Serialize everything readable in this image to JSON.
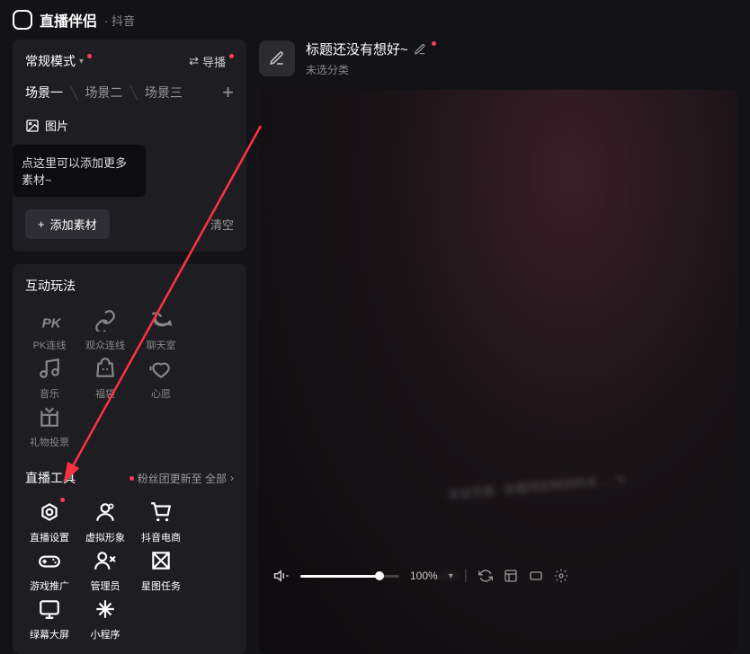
{
  "app": {
    "title": "直播伴侣",
    "subtitle": "· 抖音"
  },
  "mode": {
    "label": "常规模式",
    "nav": "导播"
  },
  "scenes": {
    "tabs": [
      "场景一",
      "场景二",
      "场景三"
    ]
  },
  "source": {
    "image": "图片"
  },
  "hint": "点这里可以添加更多素材~",
  "add": {
    "label": "添加素材",
    "clear": "清空"
  },
  "interactive": {
    "title": "互动玩法",
    "items": [
      {
        "label": "PK连线",
        "icon": "pk"
      },
      {
        "label": "观众连线",
        "icon": "link"
      },
      {
        "label": "聊天室",
        "icon": "chat"
      },
      {
        "label": "音乐",
        "icon": "music"
      },
      {
        "label": "福袋",
        "icon": "bag"
      },
      {
        "label": "心愿",
        "icon": "heart"
      },
      {
        "label": "礼物投票",
        "icon": "gift"
      }
    ]
  },
  "tools": {
    "title": "直播工具",
    "fans_update": "粉丝团更新至 全部",
    "items": [
      {
        "label": "直播设置",
        "icon": "gear",
        "dot": true
      },
      {
        "label": "虚拟形象",
        "icon": "avatar"
      },
      {
        "label": "抖音电商",
        "icon": "cart"
      },
      {
        "label": "游戏推广",
        "icon": "gamepad"
      },
      {
        "label": "管理员",
        "icon": "admin"
      },
      {
        "label": "星图任务",
        "icon": "star"
      },
      {
        "label": "绿幕大屏",
        "icon": "screen"
      },
      {
        "label": "小程序",
        "icon": "mini"
      }
    ]
  },
  "stream": {
    "title": "标题还没有想好~",
    "category": "未选分类"
  },
  "bottom": {
    "volume": "100%"
  }
}
